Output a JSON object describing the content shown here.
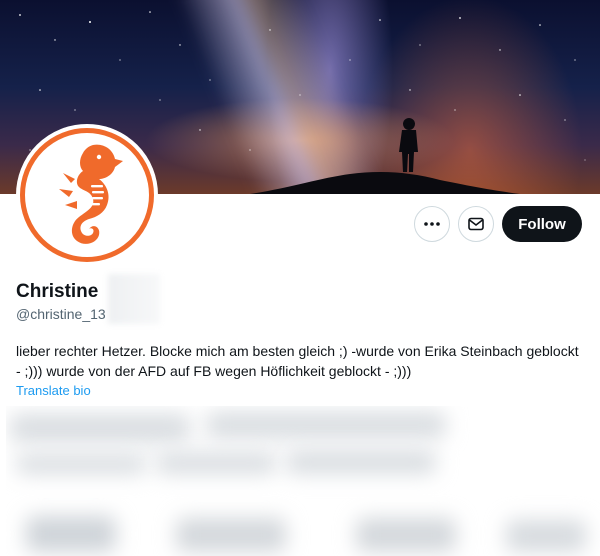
{
  "profile": {
    "name": "Christine",
    "handle": "@christine_13",
    "bio": "lieber rechter Hetzer. Blocke mich am besten gleich ;) -wurde von Erika Steinbach geblockt - ;))) wurde von der AFD auf FB wegen Höflichkeit geblockt - ;)))",
    "translate_label": "Translate bio"
  },
  "actions": {
    "follow_label": "Follow",
    "more_icon": "more-horizontal-icon",
    "message_icon": "envelope-icon"
  },
  "colors": {
    "follow_bg": "#0f1419",
    "link": "#1d9bf0",
    "avatar_accent": "#f06a2b"
  }
}
